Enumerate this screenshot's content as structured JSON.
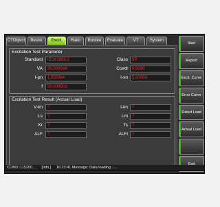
{
  "tabs": [
    {
      "label": "CTObject",
      "active": false
    },
    {
      "label": "Resist.",
      "active": false
    },
    {
      "label": "Excit.",
      "active": true
    },
    {
      "label": "Ratio",
      "active": false
    },
    {
      "label": "Burden",
      "active": false
    },
    {
      "label": "Evaluate",
      "active": false
    },
    {
      "label": "VT",
      "active": false
    },
    {
      "label": "System",
      "active": false
    }
  ],
  "parameter": {
    "title": "Excitation Test Parameter",
    "standard_label": "Standard",
    "standard_value": "IEC61869-2",
    "class_label": "Class",
    "class_value": "5P",
    "va_label": "VA",
    "va_value": "30.0000VA",
    "cos_label": "CosΦ",
    "cos_value": "0.8000",
    "ipn_label": "I-pn",
    "ipn_value": "1.0000kA",
    "isn_label": "I-sn",
    "isn_value": "5.0000A",
    "f_label": "f",
    "f_value": "50.0000Hz"
  },
  "result": {
    "title": "Excitation Test Result (Actual Load)",
    "vkn_label": "V-kn",
    "vkn_value": "?",
    "ikn_label": "I-kn",
    "ikn_value": "?",
    "ls_label": "Ls",
    "ls_value": "?",
    "lm_label": "Lm",
    "lm_value": "?",
    "kr_label": "Kr",
    "kr_value": "?",
    "ts_label": "Ts",
    "ts_value": "?",
    "alf_label": "ALF",
    "alf_value": "?",
    "alfi_label": "ALFi",
    "alfi_value": "?"
  },
  "buttons": {
    "start": "Start",
    "report": "Report",
    "excit_curve": "Excit. Curve",
    "error_curve": "Error Curve",
    "rated_load": "Rated Load",
    "actual_load": "Actual Load",
    "blank": "",
    "exit": "Exit"
  },
  "status": {
    "port": "COM3::115200....",
    "level": "[Info.]",
    "message": "16:23:41 Message: Data loading......"
  },
  "colors": {
    "accent": "#8fd629",
    "value_text": "#ff2a2a",
    "panel_bg": "#3b3b3b"
  }
}
